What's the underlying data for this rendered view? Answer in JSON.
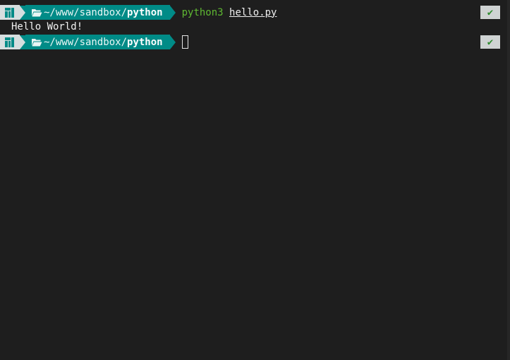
{
  "prompt": {
    "os_icon": "manjaro-logo-icon",
    "folder_icon": "folder-open-icon",
    "path_prefix": "~/www/sandbox/",
    "path_current": "python"
  },
  "history": {
    "command": "python3",
    "argument": "hello.py",
    "output": "Hello World!",
    "status_symbol": "✔"
  },
  "current": {
    "status_symbol": "✔"
  },
  "colors": {
    "background": "#1e1e1e",
    "path_segment": "#008b87",
    "os_segment": "#d6dedf",
    "command": "#5fb832",
    "status_ok": "#2e8b2e"
  }
}
